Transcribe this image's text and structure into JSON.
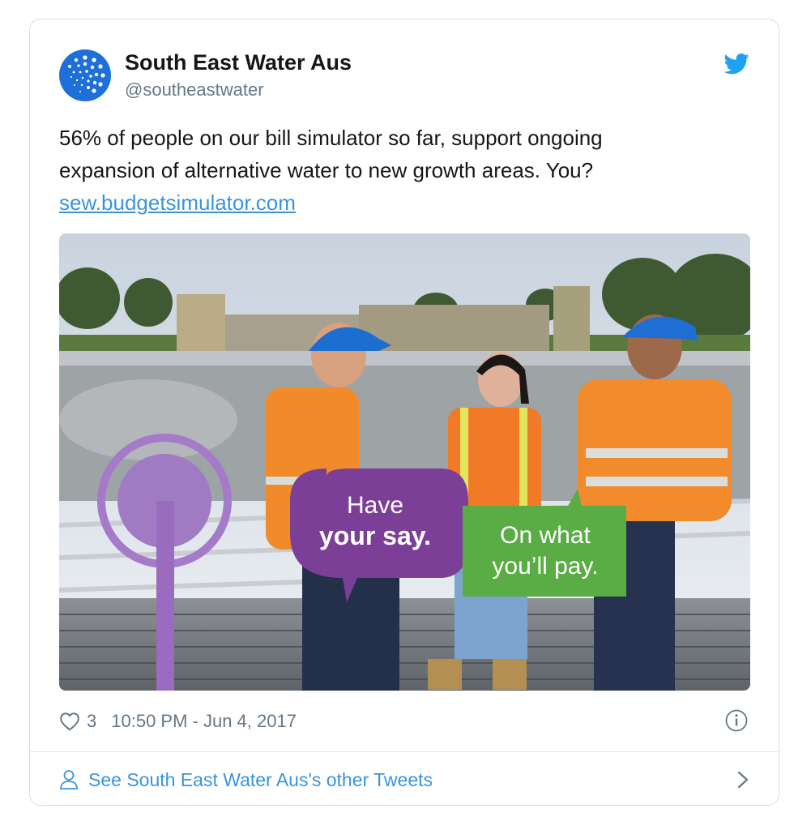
{
  "tweet": {
    "author_name": "South East Water Aus",
    "author_handle": "@southeastwater",
    "text_line1": "56% of people on our bill simulator so far, support ongoing",
    "text_line2": "expansion of alternative water to new growth areas. You?",
    "link_text": "sew.budgetsimulator.com",
    "like_count": "3",
    "timestamp": "10:50 PM - Jun 4, 2017"
  },
  "media": {
    "bubble_purple_line1": "Have",
    "bubble_purple_line2": "your say.",
    "bubble_green_line1": "On what",
    "bubble_green_line2": "you’ll pay."
  },
  "footer": {
    "label": "See South East Water Aus's other Tweets"
  },
  "icons": {
    "brand": "twitter-bird-icon",
    "like": "heart-icon",
    "info": "info-icon",
    "profile": "person-icon",
    "next": "chevron-right-icon"
  },
  "colors": {
    "link": "#3b94d9",
    "twitter_blue": "#1da1f2",
    "avatar_blue": "#1f6fd8",
    "bubble_purple": "#7b3f98",
    "bubble_green": "#5aac44"
  }
}
